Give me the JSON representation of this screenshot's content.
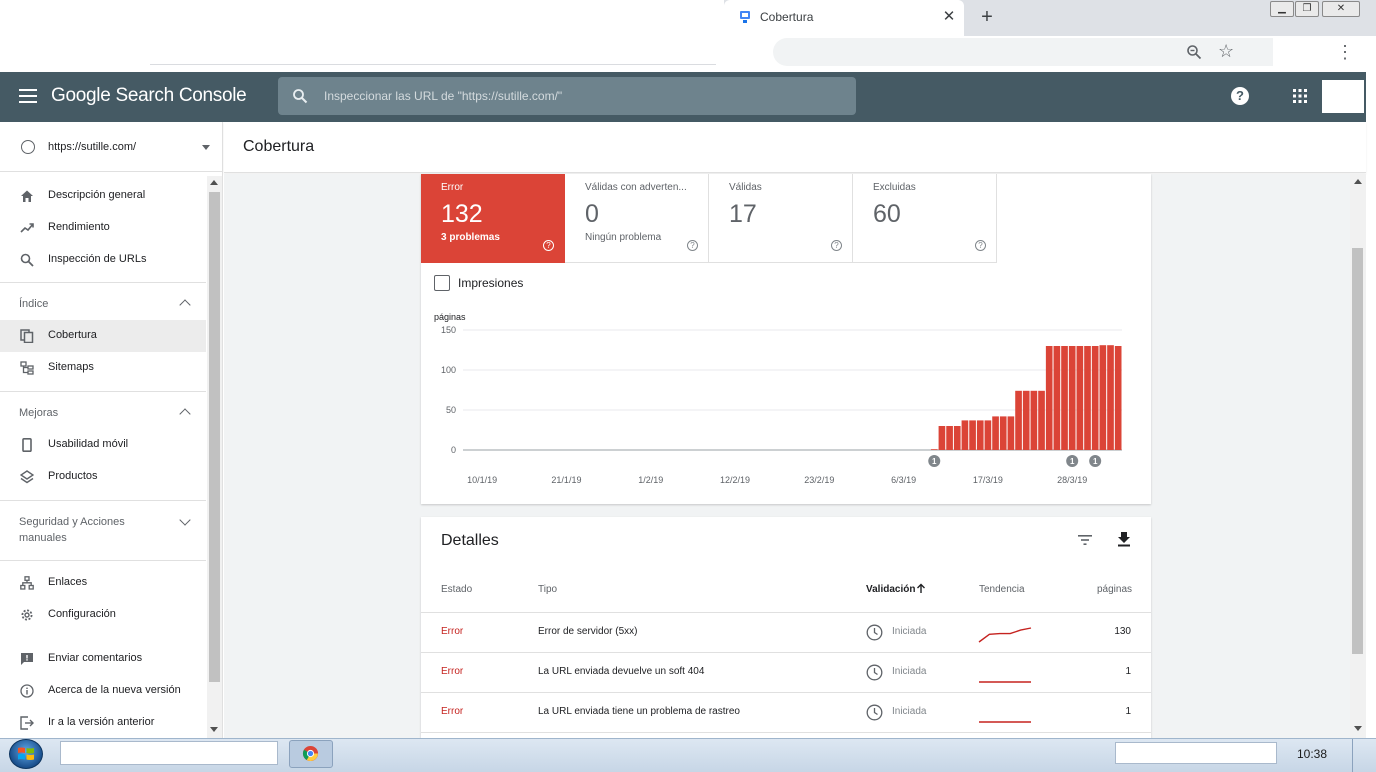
{
  "browser": {
    "tab_title": "Cobertura",
    "tab_close": "✕",
    "new_tab": "+",
    "window_buttons": [
      "▁",
      "❐",
      "✕"
    ],
    "menu_dots": "⋮"
  },
  "header": {
    "brand": "Google Search Console",
    "search_placeholder": "Inspeccionar las URL de \"https://sutille.com/\"",
    "help": "?"
  },
  "sidebar": {
    "property": "https://sutille.com/",
    "items": [
      {
        "label": "Descripción general",
        "icon": "home-icon"
      },
      {
        "label": "Rendimiento",
        "icon": "trending-up-icon"
      },
      {
        "label": "Inspección de URLs",
        "icon": "search-icon"
      }
    ],
    "sections": [
      {
        "title": "Índice",
        "expanded": true,
        "items": [
          {
            "label": "Cobertura",
            "icon": "copy-pages-icon",
            "active": true
          },
          {
            "label": "Sitemaps",
            "icon": "sitemap-icon"
          }
        ]
      },
      {
        "title": "Mejoras",
        "expanded": true,
        "items": [
          {
            "label": "Usabilidad móvil",
            "icon": "phone-icon"
          },
          {
            "label": "Productos",
            "icon": "layers-icon"
          }
        ]
      },
      {
        "title_line1": "Seguridad y Acciones",
        "title_line2": "manuales",
        "expanded": false
      }
    ],
    "bottom_items": [
      {
        "label": "Enlaces",
        "icon": "links-icon"
      },
      {
        "label": "Configuración",
        "icon": "gear-icon"
      },
      {
        "label": "Enviar comentarios",
        "icon": "feedback-icon"
      },
      {
        "label": "Acerca de la nueva versión",
        "icon": "info-icon"
      },
      {
        "label": "Ir a la versión anterior",
        "icon": "exit-icon"
      }
    ]
  },
  "page": {
    "title": "Cobertura"
  },
  "summary": {
    "tiles": [
      {
        "label": "Error",
        "value": "132",
        "sub": "3 problemas",
        "help": "?"
      },
      {
        "label": "Válidas con adverten...",
        "value": "0",
        "sub": "Ningún problema",
        "help": "?"
      },
      {
        "label": "Válidas",
        "value": "17",
        "sub": "",
        "help": "?"
      },
      {
        "label": "Excluidas",
        "value": "60",
        "sub": "",
        "help": "?"
      }
    ],
    "impressions_label": "Impresiones"
  },
  "chart_data": {
    "type": "bar",
    "ylabel": "páginas",
    "ylim": [
      0,
      150
    ],
    "yticks": [
      0,
      50,
      100,
      150
    ],
    "xtick_labels": [
      "10/1/19",
      "21/1/19",
      "1/2/19",
      "12/2/19",
      "23/2/19",
      "6/3/19",
      "17/3/19",
      "28/3/19"
    ],
    "x_start": "2019-01-08",
    "x_end": "2019-04-03",
    "series": [
      {
        "color": "#db4437",
        "values": [
          0,
          0,
          0,
          0,
          0,
          0,
          0,
          0,
          0,
          0,
          0,
          0,
          0,
          0,
          0,
          0,
          0,
          0,
          0,
          0,
          0,
          0,
          0,
          0,
          0,
          0,
          0,
          0,
          0,
          0,
          0,
          0,
          0,
          0,
          0,
          0,
          0,
          0,
          0,
          0,
          0,
          0,
          0,
          0,
          0,
          0,
          0,
          0,
          0,
          0,
          0,
          0,
          0,
          0,
          0,
          0,
          0,
          0,
          0,
          0,
          1,
          30,
          30,
          30,
          37,
          37,
          37,
          37,
          42,
          42,
          42,
          74,
          74,
          74,
          74,
          130,
          130,
          130,
          130,
          130,
          130,
          130,
          131,
          131,
          130
        ]
      }
    ],
    "annotations": [
      {
        "date": "2019-03-10",
        "label": "1"
      },
      {
        "date": "2019-03-28",
        "label": "1"
      },
      {
        "date": "2019-03-31",
        "label": "1"
      }
    ]
  },
  "details": {
    "title": "Detalles",
    "columns": {
      "estado": "Estado",
      "tipo": "Tipo",
      "validacion": "Validación",
      "tendencia": "Tendencia",
      "paginas": "páginas"
    },
    "rows": [
      {
        "estado": "Error",
        "tipo": "Error de servidor (5xx)",
        "validacion": "Iniciada",
        "paginas": "130",
        "trend": [
          0,
          0.55,
          0.6,
          0.6,
          0.85,
          1
        ]
      },
      {
        "estado": "Error",
        "tipo": "La URL enviada devuelve un soft 404",
        "validacion": "Iniciada",
        "paginas": "1",
        "trend": [
          0,
          0,
          0,
          0,
          0,
          0
        ]
      },
      {
        "estado": "Error",
        "tipo": "La URL enviada tiene un problema de rastreo",
        "validacion": "Iniciada",
        "paginas": "1",
        "trend": [
          0,
          0,
          0,
          0,
          0,
          0
        ]
      }
    ]
  },
  "taskbar": {
    "clock": "10:38"
  }
}
